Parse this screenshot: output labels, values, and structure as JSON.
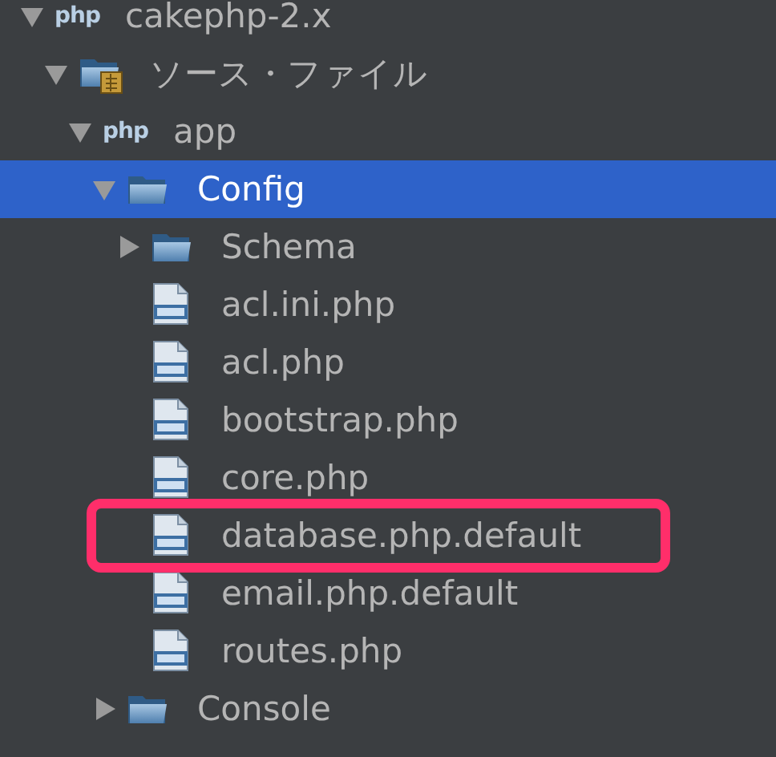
{
  "tree": [
    {
      "label": "cakephp-2.x",
      "kind": "project",
      "badge": "php",
      "expanded": true,
      "selected": false,
      "children": [
        {
          "label": "ソース・ファイル",
          "kind": "sources",
          "expanded": true,
          "selected": false,
          "children": [
            {
              "label": "app",
              "kind": "project",
              "badge": "php",
              "expanded": true,
              "selected": false,
              "children": [
                {
                  "label": "Config",
                  "kind": "folder",
                  "expanded": true,
                  "selected": true,
                  "children": [
                    {
                      "label": "Schema",
                      "kind": "folder",
                      "expanded": false,
                      "selected": false
                    },
                    {
                      "label": "acl.ini.php",
                      "kind": "file",
                      "selected": false
                    },
                    {
                      "label": "acl.php",
                      "kind": "file",
                      "selected": false
                    },
                    {
                      "label": "bootstrap.php",
                      "kind": "file",
                      "selected": false
                    },
                    {
                      "label": "core.php",
                      "kind": "file",
                      "selected": false
                    },
                    {
                      "label": "database.php.default",
                      "kind": "file",
                      "selected": false,
                      "highlighted": true
                    },
                    {
                      "label": "email.php.default",
                      "kind": "file",
                      "selected": false
                    },
                    {
                      "label": "routes.php",
                      "kind": "file",
                      "selected": false
                    }
                  ]
                },
                {
                  "label": "Console",
                  "kind": "folder",
                  "expanded": false,
                  "selected": false
                }
              ]
            }
          ]
        }
      ]
    }
  ]
}
